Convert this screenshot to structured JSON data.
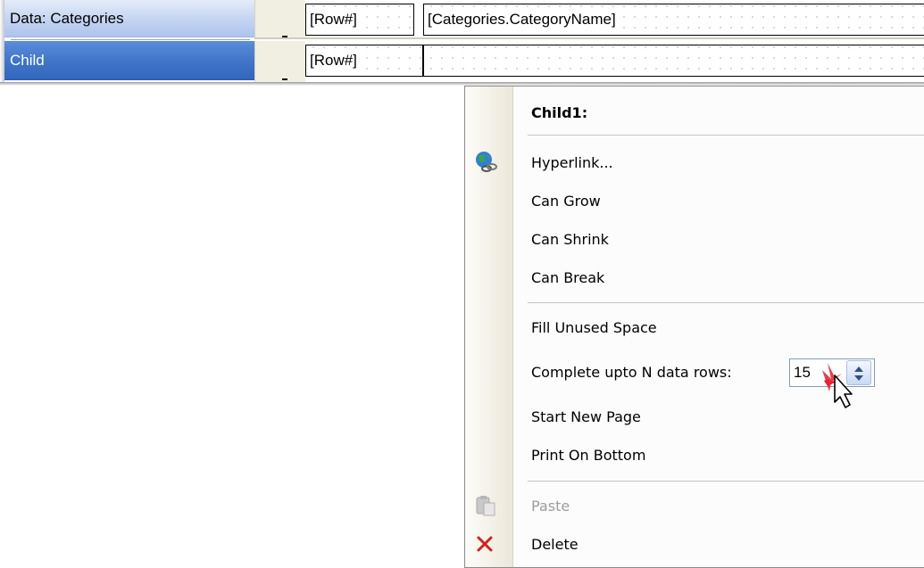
{
  "bands": {
    "data_band": {
      "label": "Data: Categories",
      "row_cell": "[Row#]",
      "field_cell": "[Categories.CategoryName]"
    },
    "child_band": {
      "label": "Child",
      "row_cell": "[Row#]"
    }
  },
  "context_menu": {
    "title": "Child1:",
    "items": {
      "hyperlink": {
        "label": "Hyperlink...",
        "icon": "globe-link-icon"
      },
      "can_grow": {
        "label": "Can Grow"
      },
      "can_shrink": {
        "label": "Can Shrink"
      },
      "can_break": {
        "label": "Can Break"
      },
      "fill_unused_space": {
        "label": "Fill Unused Space"
      },
      "complete_rows": {
        "label": "Complete upto N data rows:",
        "value": "15"
      },
      "start_new_page": {
        "label": "Start New Page"
      },
      "print_on_bottom": {
        "label": "Print On Bottom"
      },
      "paste": {
        "label": "Paste",
        "icon": "paste-icon",
        "disabled": true
      },
      "delete": {
        "label": "Delete",
        "icon": "delete-icon"
      }
    }
  },
  "colors": {
    "band_selected": "#3f74c9",
    "band_normal": "#c3d4f1",
    "delete_icon": "#d81f1f",
    "menu_strip": "#ebe8d9"
  }
}
